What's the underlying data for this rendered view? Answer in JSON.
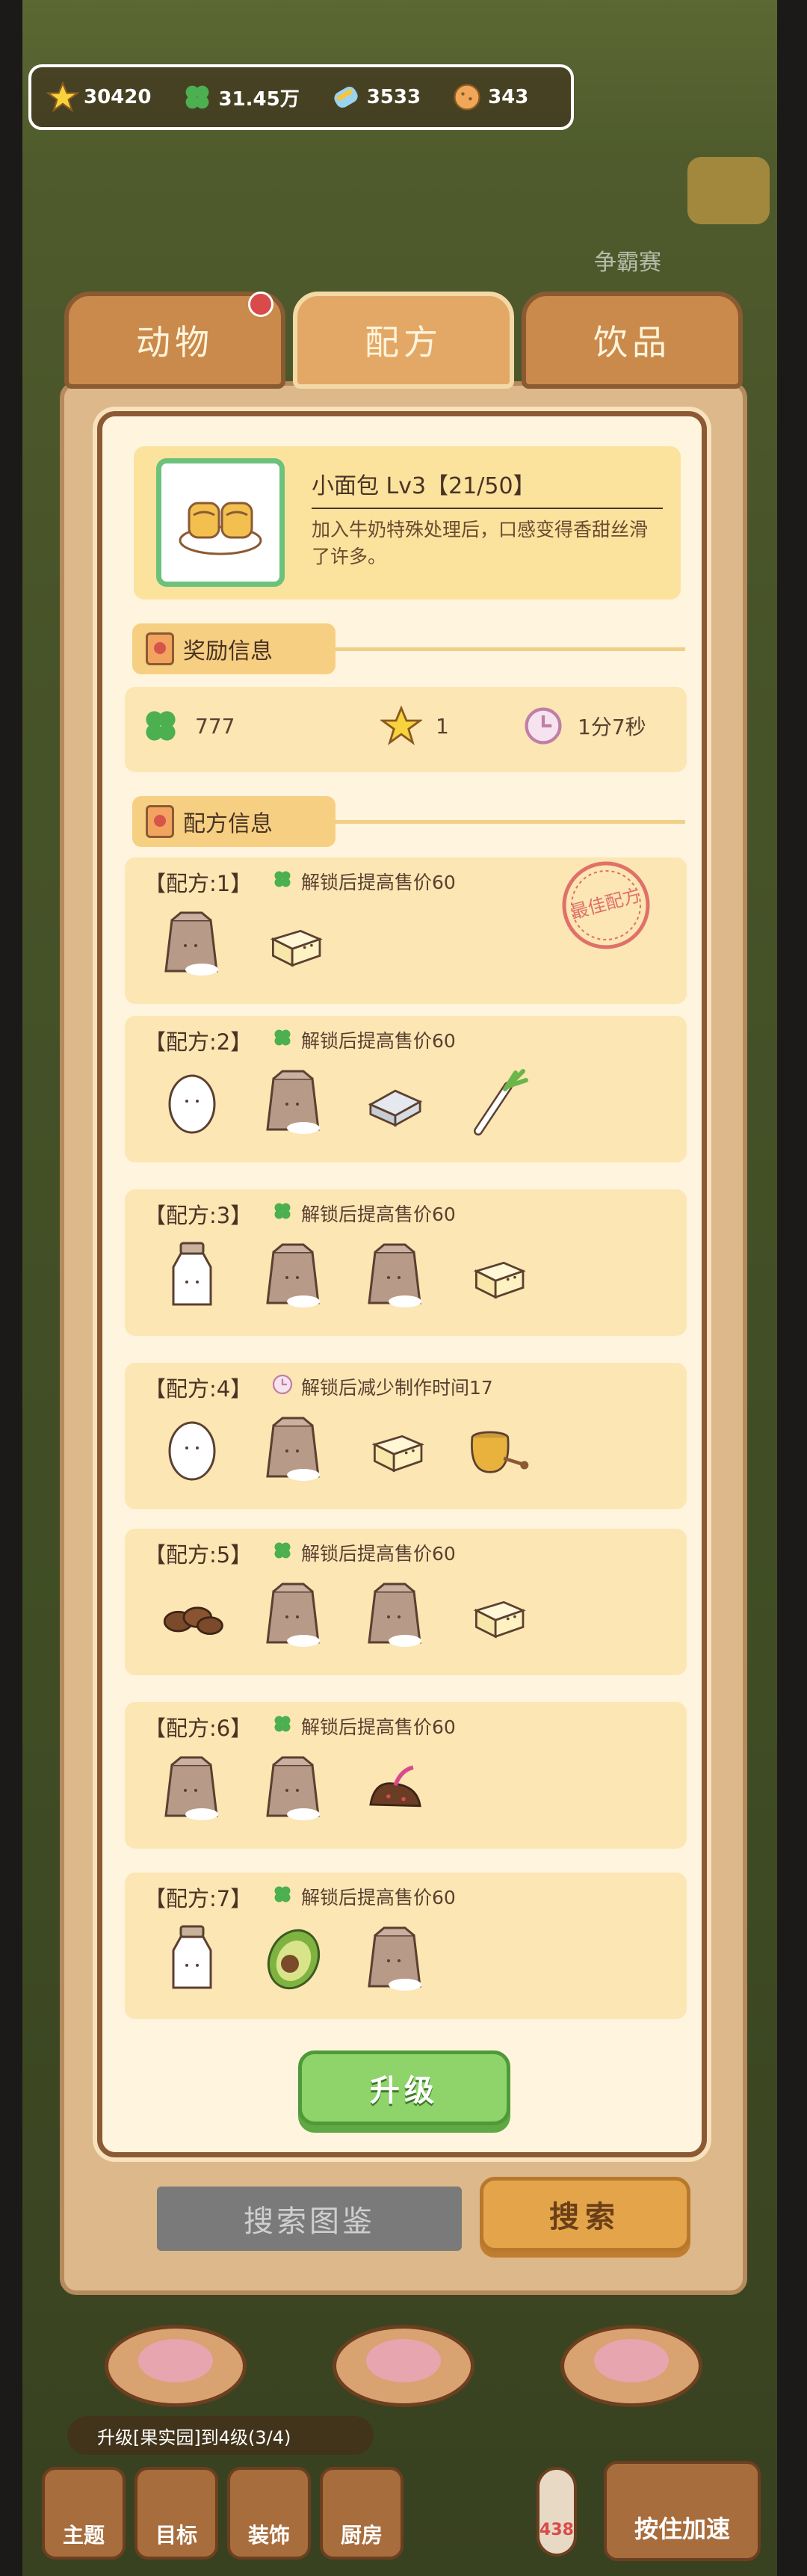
{
  "currency": {
    "stars": "30420",
    "clover": "31.45万",
    "candy": "3533",
    "cookie": "343"
  },
  "background": {
    "rank_label": "争霸赛"
  },
  "tabs": [
    {
      "label": "动物",
      "active": false,
      "has_badge": true
    },
    {
      "label": "配方",
      "active": true,
      "has_badge": false
    },
    {
      "label": "饮品",
      "active": false,
      "has_badge": false
    }
  ],
  "item": {
    "title": "小面包 Lv3【21/50】",
    "description": "加入牛奶特殊处理后，口感变得香甜丝滑了许多。"
  },
  "reward_section": {
    "label": "奖励信息",
    "clover": "777",
    "star": "1",
    "time": "1分7秒"
  },
  "recipe_section": {
    "label": "配方信息",
    "best_stamp": "最佳配方"
  },
  "recipes": [
    {
      "title": "【配方:1】",
      "hint_icon": "clover-icon",
      "hint": "解锁后提高售价60",
      "best": true,
      "ingredients": [
        "flour-sack-icon",
        "butter-icon"
      ]
    },
    {
      "title": "【配方:2】",
      "hint_icon": "clover-icon",
      "hint": "解锁后提高售价60",
      "best": false,
      "ingredients": [
        "egg-icon",
        "flour-sack-icon",
        "salt-icon",
        "scallion-icon"
      ]
    },
    {
      "title": "【配方:3】",
      "hint_icon": "clover-icon",
      "hint": "解锁后提高售价60",
      "best": false,
      "ingredients": [
        "milk-bottle-icon",
        "flour-sack-icon",
        "flour-sack-icon",
        "butter-icon"
      ]
    },
    {
      "title": "【配方:4】",
      "hint_icon": "clock-icon",
      "hint": "解锁后减少制作时间17",
      "best": false,
      "ingredients": [
        "egg-icon",
        "flour-sack-icon",
        "butter-icon",
        "honey-jar-icon"
      ]
    },
    {
      "title": "【配方:5】",
      "hint_icon": "clover-icon",
      "hint": "解锁后提高售价60",
      "best": false,
      "ingredients": [
        "coffee-beans-icon",
        "flour-sack-icon",
        "flour-sack-icon",
        "butter-icon"
      ]
    },
    {
      "title": "【配方:6】",
      "hint_icon": "clover-icon",
      "hint": "解锁后提高售价60",
      "best": false,
      "ingredients": [
        "flour-sack-icon",
        "flour-sack-icon",
        "chocolate-icon"
      ]
    },
    {
      "title": "【配方:7】",
      "hint_icon": "clover-icon",
      "hint": "解锁后提高售价60",
      "best": false,
      "ingredients": [
        "milk-bottle-icon",
        "avocado-icon",
        "flour-sack-icon"
      ]
    }
  ],
  "upgrade_button": "升级",
  "search": {
    "placeholder": "搜索图鉴",
    "button": "搜索"
  },
  "bottom": {
    "hint": "升级[果实园]到4级(3/4)",
    "nav": [
      "主题",
      "目标",
      "装饰",
      "厨房"
    ],
    "thermo_value": "438",
    "speed_button": "按住加速"
  }
}
